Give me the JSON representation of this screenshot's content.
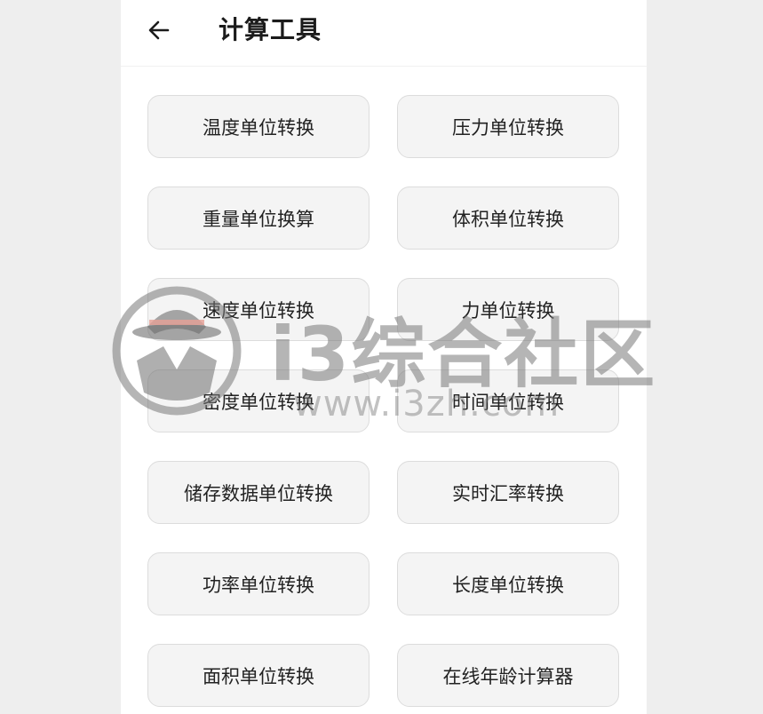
{
  "header": {
    "title": "计算工具",
    "back_icon": "arrow-left-icon"
  },
  "tools": [
    {
      "label": "温度单位转换"
    },
    {
      "label": "压力单位转换"
    },
    {
      "label": "重量单位换算"
    },
    {
      "label": "体积单位转换"
    },
    {
      "label": "速度单位转换"
    },
    {
      "label": "力单位转换"
    },
    {
      "label": "密度单位转换"
    },
    {
      "label": "时间单位转换"
    },
    {
      "label": "储存数据单位转换"
    },
    {
      "label": "实时汇率转换"
    },
    {
      "label": "功率单位转换"
    },
    {
      "label": "长度单位转换"
    },
    {
      "label": "面积单位转换"
    },
    {
      "label": "在线年龄计算器"
    }
  ],
  "watermark": {
    "text": "i3综合社区",
    "url": "www.i3zh.com"
  }
}
